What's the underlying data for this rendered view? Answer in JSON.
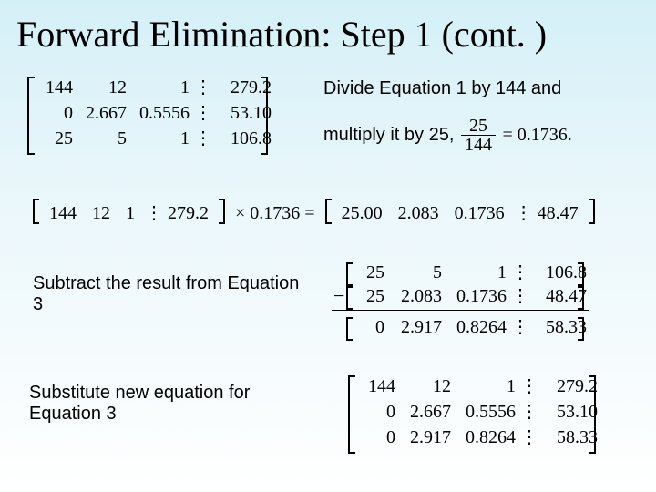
{
  "title": "Forward Elimination: Step 1 (cont. )",
  "instr": {
    "line1": "Divide Equation 1 by 144 and",
    "line2a": "multiply it by 25, ",
    "frac_num": "25",
    "frac_den": "144",
    "frac_eq": " = 0.1736.",
    "subtract": "Subtract the result from Equation 3",
    "substitute": "Substitute new equation for Equation 3"
  },
  "sep_glyph": "⋮",
  "mat1": {
    "r1": {
      "c1": "144",
      "c2": "12",
      "c3": "1",
      "c4": "279.2"
    },
    "r2": {
      "c1": "0",
      "c2": "2.667",
      "c3": "0.5556",
      "c4": "53.10"
    },
    "r3": {
      "c1": "25",
      "c2": "5",
      "c3": "1",
      "c4": "106.8"
    }
  },
  "roweq": {
    "lhs": {
      "c1": "144",
      "c2": "12",
      "c3": "1",
      "c4": "279.2"
    },
    "times": "× 0.1736 =",
    "rhs": {
      "c1": "25.00",
      "c2": "2.083",
      "c3": "0.1736",
      "c4": "48.47"
    }
  },
  "sub": {
    "top": {
      "c1": "25",
      "c2": "5",
      "c3": "1",
      "c4": "106.8"
    },
    "mid": {
      "c1": "25",
      "c2": "2.083",
      "c3": "0.1736",
      "c4": "48.47"
    },
    "bot": {
      "c1": "0",
      "c2": "2.917",
      "c3": "0.8264",
      "c4": "58.33"
    },
    "minus": "−"
  },
  "mat2": {
    "r1": {
      "c1": "144",
      "c2": "12",
      "c3": "1",
      "c4": "279.2"
    },
    "r2": {
      "c1": "0",
      "c2": "2.667",
      "c3": "0.5556",
      "c4": "53.10"
    },
    "r3": {
      "c1": "0",
      "c2": "2.917",
      "c3": "0.8264",
      "c4": "58.33"
    }
  }
}
